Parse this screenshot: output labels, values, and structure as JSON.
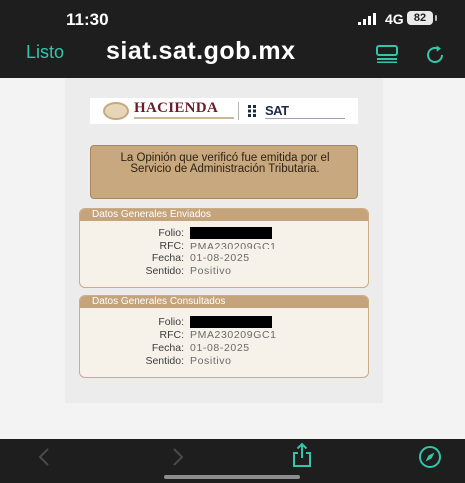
{
  "status_bar": {
    "time": "11:30",
    "network": "4G",
    "battery": "82"
  },
  "browser": {
    "done_label": "Listo",
    "url": "siat.sat.gob.mx"
  },
  "logos": {
    "hacienda": "HACIENDA",
    "sat": "SAT"
  },
  "notice": {
    "text": "La Opinión que verificó fue emitida por el Servicio de Administración Tributaria."
  },
  "sent": {
    "title": "Datos Generales Enviados",
    "folio_label": "Folio:",
    "rfc_label": "RFC:",
    "rfc_value": "PMA230209GC1",
    "fecha_label": "Fecha:",
    "fecha_value": "01-08-2025",
    "sentido_label": "Sentido:",
    "sentido_value": "Positivo"
  },
  "consulted": {
    "title": "Datos Generales Consultados",
    "folio_label": "Folio:",
    "rfc_label": "RFC:",
    "rfc_value": "PMA230209GC1",
    "fecha_label": "Fecha:",
    "fecha_value": "01-08-2025",
    "sentido_label": "Sentido:",
    "sentido_value": "Positivo"
  },
  "colors": {
    "accent": "#33c6a8",
    "panel_header": "#c5a47b",
    "notice_bg": "#c8a87e",
    "toolbar_bg": "#1e1e1e"
  },
  "icons": [
    "reader-icon",
    "reload-icon",
    "back-icon",
    "forward-icon",
    "share-icon",
    "compass-icon"
  ]
}
